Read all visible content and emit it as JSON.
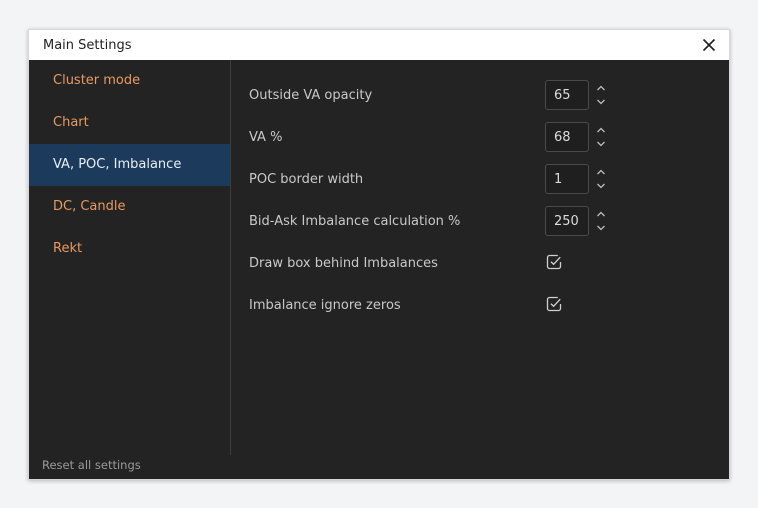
{
  "dialog": {
    "title": "Main Settings",
    "close_icon": "close-icon"
  },
  "sidebar": {
    "items": [
      {
        "label": "Cluster mode",
        "active": false
      },
      {
        "label": "Chart",
        "active": false
      },
      {
        "label": "VA, POC, Imbalance",
        "active": true
      },
      {
        "label": "DC, Candle",
        "active": false
      },
      {
        "label": "Rekt",
        "active": false
      }
    ],
    "reset_label": "Reset all settings"
  },
  "settings": {
    "outside_va_opacity": {
      "label": "Outside VA opacity",
      "value": "65"
    },
    "va_percent": {
      "label": "VA %",
      "value": "68"
    },
    "poc_border_width": {
      "label": "POC border width",
      "value": "1"
    },
    "bid_ask_imbalance": {
      "label": "Bid-Ask Imbalance calculation %",
      "value": "250"
    },
    "draw_box": {
      "label": "Draw box behind Imbalances",
      "checked": true
    },
    "ignore_zeros": {
      "label": "Imbalance ignore zeros",
      "checked": true
    }
  },
  "colors": {
    "dialog_bg": "#232323",
    "titlebar_bg": "#ffffff",
    "nav_text": "#e79a61",
    "nav_active_bg": "#1c3a5c",
    "label_text": "#c9c9c9"
  }
}
